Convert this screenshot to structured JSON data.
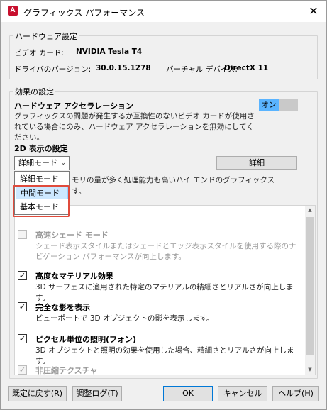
{
  "window": {
    "title": "グラフィックス パフォーマンス",
    "app_icon_letter": "A"
  },
  "hardware": {
    "group_title": "ハードウェア設定",
    "video_card_label": "ビデオ カード:",
    "video_card_value": "NVIDIA Tesla T4",
    "driver_label": "ドライバのバージョン:",
    "driver_value": "30.0.15.1278",
    "virtual_device_label": "バーチャル デバイス:",
    "virtual_device_value": "DirectX 11"
  },
  "effects": {
    "group_title": "効果の設定",
    "accel_title": "ハードウェア アクセラレーション",
    "accel_desc": "グラフィックスの問題が発生するか互換性のないビデオ カードが使用されている場合にのみ、ハードウェア アクセラレーションを無効にしてください。",
    "toggle_label": "オン",
    "toggle_on": true,
    "d2_title": "2D 表示の設定",
    "combo_value": "詳細モード",
    "detail_button": "詳細",
    "d2_desc_line1": "モリの量が多く処理能力も高いハイ エンドのグラフィックス",
    "d2_desc_line2": "す。",
    "dropdown_options": [
      "詳細モード",
      "中間モード",
      "基本モード"
    ],
    "dropdown_selected": "中間モード",
    "options": [
      {
        "title": "高速シェード モード",
        "desc": "シェード表示スタイルまたはシェードとエッジ表示スタイルを使用する際のナビゲーション パフォーマンスが向上します。",
        "checked": false,
        "enabled": false
      },
      {
        "title": "高度なマテリアル効果",
        "desc": "3D サーフェスに適用された特定のマテリアルの精細さとリアルさが向上します。",
        "checked": true,
        "enabled": true
      },
      {
        "title": "完全な影を表示",
        "desc": "ビューポートで 3D オブジェクトの影を表示します。",
        "checked": true,
        "enabled": true
      },
      {
        "title": "ピクセル単位の照明(フォン)",
        "desc": "3D オブジェクトと照明の効果を使用した場合、精細さとリアルさが向上します。",
        "checked": true,
        "enabled": true
      },
      {
        "title": "非圧縮テクスチャ",
        "desc": "",
        "checked": true,
        "enabled": false
      }
    ]
  },
  "buttons": {
    "reset": "既定に戻す(R)",
    "tuning_log": "調整ログ(T)",
    "ok": "OK",
    "cancel": "キャンセル",
    "help": "ヘルプ(H)"
  },
  "colors": {
    "toggle_accent": "#5ab4ff",
    "highlight_box": "#e04b3c",
    "selected_item": "#cce8ff"
  }
}
